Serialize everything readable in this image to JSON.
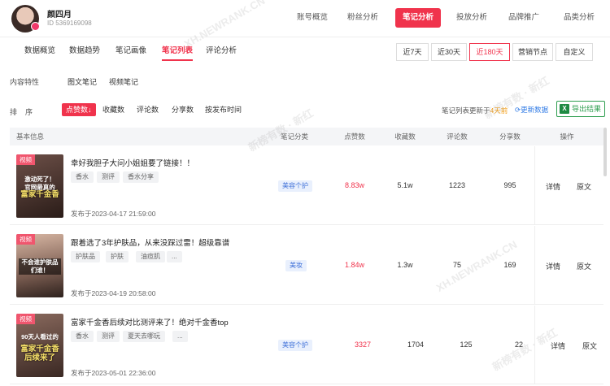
{
  "header": {
    "user_name": "颜四月",
    "user_id": "ID 5369169098",
    "nav": [
      "账号概览",
      "粉丝分析",
      "笔记分析",
      "投放分析",
      "品牌推广",
      "品类分析"
    ]
  },
  "subtabs": [
    "数据概览",
    "数据趋势",
    "笔记画像",
    "笔记列表",
    "评论分析"
  ],
  "ranges": [
    "近7天",
    "近30天",
    "近180天",
    "营销节点",
    "自定义"
  ],
  "filters": {
    "content_label": "内容特性",
    "content_options": [
      "图文笔记",
      "视频笔记"
    ],
    "sort_label": "排    序",
    "sort_options": [
      "点赞数↓",
      "收藏数",
      "评论数",
      "分享数",
      "按发布时间"
    ]
  },
  "update": {
    "prefix": "笔记列表更新于",
    "highlight": "4天前",
    "refresh_label": "更新数据",
    "export_label": "导出结果"
  },
  "table": {
    "headers": [
      "基本信息",
      "笔记分类",
      "点赞数",
      "收藏数",
      "评论数",
      "分享数",
      "操作"
    ],
    "rows": [
      {
        "thumb_tag": "视频",
        "thumb_caption": "激动死了！\n官网最真的",
        "thumb_caption2": "富家千金香",
        "title": "幸好我胆子大问小姐姐要了链接！！",
        "tags": [
          "香水",
          "测评",
          "香水分享"
        ],
        "date": "发布于2023-04-17 21:59:00",
        "category": "美容个护",
        "likes": "8.83w",
        "favorites": "5.1w",
        "comments": "1223",
        "shares": "995",
        "op_detail": "详情",
        "op_source": "原文"
      },
      {
        "thumb_tag": "视频",
        "thumb_caption": "不会谁护肤品们谁！",
        "thumb_caption2": "",
        "title": "跟着选了3年护肤品，从来没踩过雷！超级靠谱",
        "tags": [
          "护肤品",
          "护肤",
          "油痘肌",
          "..."
        ],
        "date": "发布于2023-04-19 20:58:00",
        "category": "美妆",
        "likes": "1.84w",
        "favorites": "1.3w",
        "comments": "75",
        "shares": "169",
        "op_detail": "详情",
        "op_source": "原文"
      },
      {
        "thumb_tag": "视频",
        "thumb_caption": "90天人看过的",
        "thumb_caption2": "富家千金香\n后续来了",
        "title": "富家千金香后续对比测评来了！绝对千金香top",
        "tags": [
          "香水",
          "测评",
          "夏天去哪玩",
          "..."
        ],
        "date": "发布于2023-05-01 22:36:00",
        "category": "美容个护",
        "likes": "3327",
        "favorites": "1704",
        "comments": "125",
        "shares": "22",
        "op_detail": "详情",
        "op_source": "原文"
      }
    ]
  },
  "watermarks": [
    "新榜有数 · 新红",
    "XH.NEWRANK.CN",
    "XH.NEWRANK.CN",
    "新榜有数 · 新红",
    "新榜有数 · 新红"
  ],
  "colors": {
    "accent": "#f0334c",
    "link": "#2f7ae5",
    "excel": "#2e9e4f",
    "orange": "#f39c12"
  }
}
